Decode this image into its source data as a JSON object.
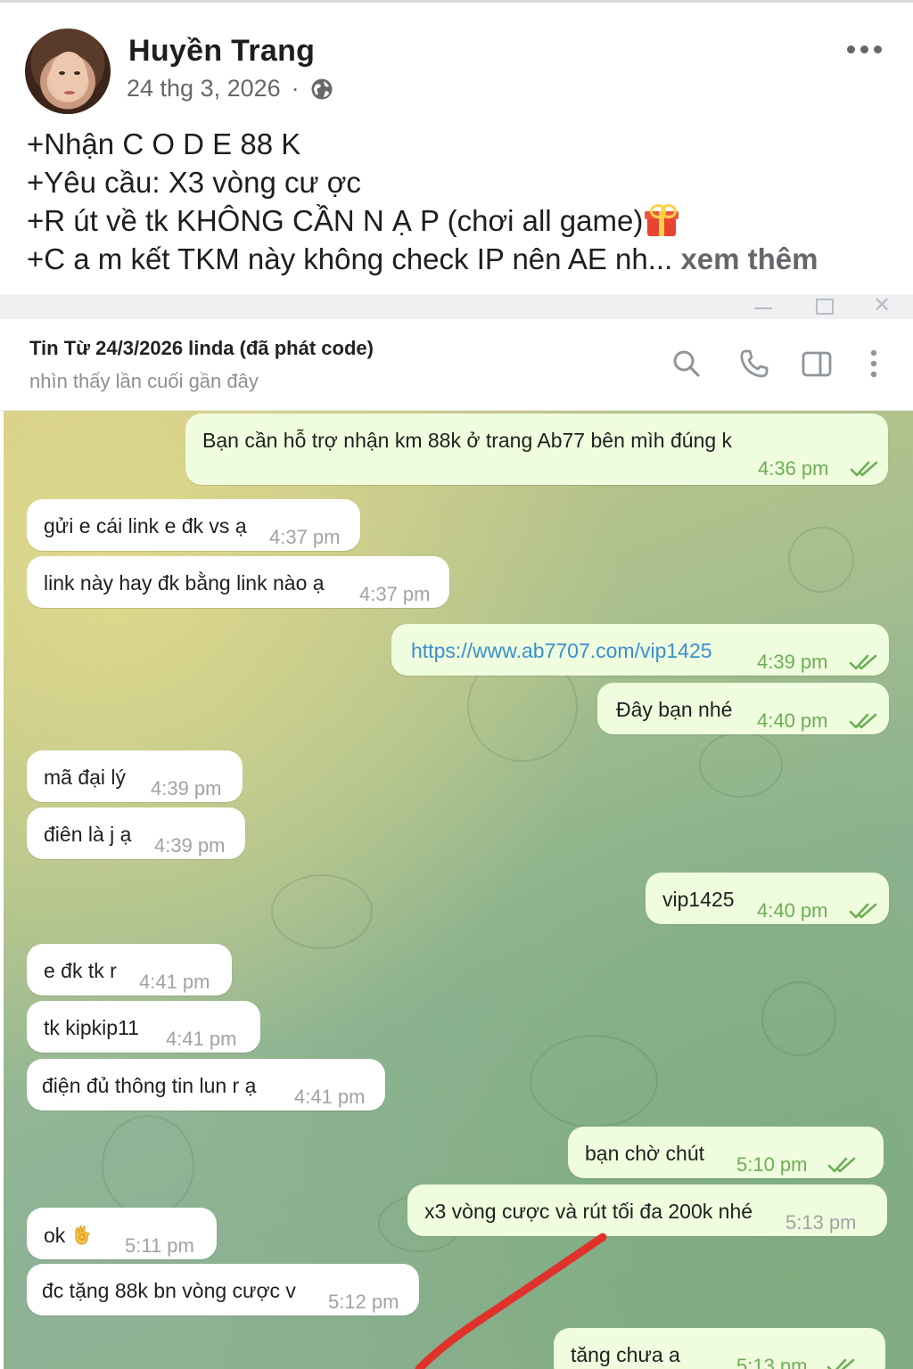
{
  "post": {
    "author": "Huyền Trang",
    "date": "24 thg 3, 2026",
    "separator": "·",
    "visibility_icon": "globe-icon",
    "more_icon": "more-options-icon",
    "lines": [
      "+Nhận C O D E 88 K",
      "+Yêu cầu: X3 vòng cư ợc",
      "+R út về tk KHÔNG CẦN N Ạ P (chơi all game)",
      "+C a m kết TKM này không check IP nên AE nh..."
    ],
    "see_more": "xem thêm"
  },
  "chat": {
    "title": "Tin Từ 24/3/2026 linda (đã phát code)",
    "status": "nhìn thấy lần cuối gần đây",
    "header_icons": [
      "search-icon",
      "phone-icon",
      "sidebar-toggle-icon",
      "kebab-menu-icon"
    ],
    "window_controls": [
      "minimize",
      "maximize",
      "close"
    ],
    "messages": [
      {
        "dir": "out",
        "text": "Bạn cần hỗ trợ nhận km 88k ở trang Ab77 bên mìh đúng k",
        "time": "4:36 pm",
        "read": true
      },
      {
        "dir": "in",
        "text": "gửi e cái link e đk vs ạ",
        "time": "4:37 pm"
      },
      {
        "dir": "in",
        "text": "link này hay đk bằng link nào ạ",
        "time": "4:37 pm"
      },
      {
        "dir": "out",
        "text": "https://www.ab7707.com/vip1425",
        "time": "4:39 pm",
        "read": true,
        "is_link": true
      },
      {
        "dir": "out",
        "text": "Đây bạn nhé",
        "time": "4:40 pm",
        "read": true
      },
      {
        "dir": "in",
        "text": "mã đại lý",
        "time": "4:39 pm"
      },
      {
        "dir": "in",
        "text": "điên là j ạ",
        "time": "4:39 pm"
      },
      {
        "dir": "out",
        "text": "vip1425",
        "time": "4:40 pm",
        "read": true
      },
      {
        "dir": "in",
        "text": "e đk tk r",
        "time": "4:41 pm"
      },
      {
        "dir": "in",
        "text": "tk kipkip11",
        "time": "4:41 pm"
      },
      {
        "dir": "in",
        "text": "điện đủ thông tin lun r ạ",
        "time": "4:41 pm"
      },
      {
        "dir": "out",
        "text": "bạn chờ chút",
        "time": "5:10 pm",
        "read": true
      },
      {
        "dir": "out",
        "text": "x3 vòng cược và rút tối đa 200k nhé",
        "time": "5:13 pm",
        "read": false
      },
      {
        "dir": "in",
        "text": "ok",
        "emoji": "ok-hand-emoji",
        "time": "5:11 pm"
      },
      {
        "dir": "in",
        "text": "đc tặng 88k bn vòng cược v",
        "time": "5:12 pm"
      },
      {
        "dir": "out",
        "text": "tăng chưa a",
        "time": "5:13 pm",
        "read": true
      }
    ]
  },
  "colors": {
    "outgoing_bubble": "#effdde",
    "incoming_bubble": "#ffffff",
    "read_ticks": "#6cae55",
    "link": "#3a8fd0",
    "annotation_arrow": "#e0322b"
  }
}
